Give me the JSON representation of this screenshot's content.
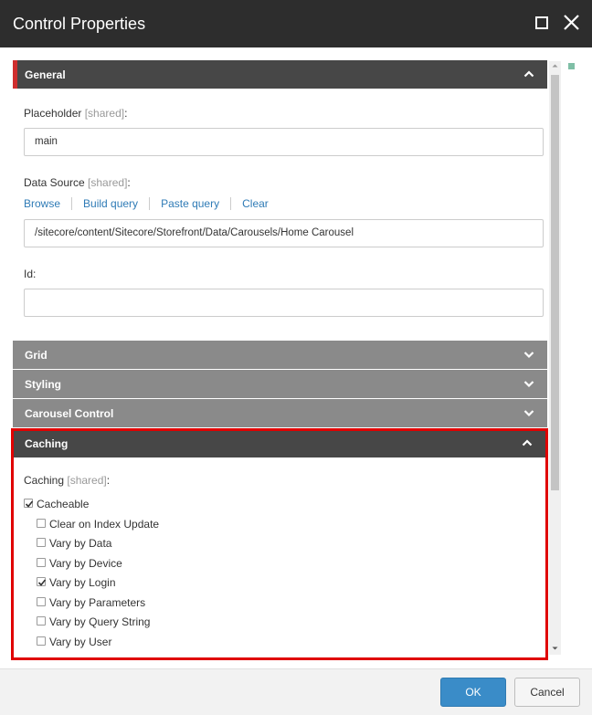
{
  "window": {
    "title": "Control Properties",
    "maximize_icon": "maximize-icon",
    "close_icon": "close-icon"
  },
  "sections": {
    "general": {
      "label": "General",
      "expanded": true
    },
    "grid": {
      "label": "Grid",
      "expanded": false
    },
    "styling": {
      "label": "Styling",
      "expanded": false
    },
    "carousel": {
      "label": "Carousel Control",
      "expanded": false
    },
    "caching": {
      "label": "Caching",
      "expanded": true
    }
  },
  "general": {
    "placeholder": {
      "label": "Placeholder",
      "shared": "[shared]",
      "suffix": ":",
      "value": "main"
    },
    "datasource": {
      "label": "Data Source",
      "shared": "[shared]",
      "suffix": ":",
      "value": "/sitecore/content/Sitecore/Storefront/Data/Carousels/Home Carousel"
    },
    "links": [
      "Browse",
      "Build query",
      "Paste query",
      "Clear"
    ],
    "id": {
      "label": "Id:",
      "value": ""
    }
  },
  "caching": {
    "label": "Caching",
    "shared": "[shared]",
    "suffix": ":",
    "options": [
      {
        "label": "Cacheable",
        "checked": true
      },
      {
        "label": "Clear on Index Update",
        "checked": false
      },
      {
        "label": "Vary by Data",
        "checked": false
      },
      {
        "label": "Vary by Device",
        "checked": false
      },
      {
        "label": "Vary by Login",
        "checked": true
      },
      {
        "label": "Vary by Parameters",
        "checked": false
      },
      {
        "label": "Vary by Query String",
        "checked": false
      },
      {
        "label": "Vary by User",
        "checked": false
      }
    ]
  },
  "footer": {
    "ok": "OK",
    "cancel": "Cancel"
  },
  "colors": {
    "accent": "#cf2e2e",
    "highlight": "#e00000",
    "primary": "#3a8cc8",
    "link": "#2f7bb6"
  }
}
